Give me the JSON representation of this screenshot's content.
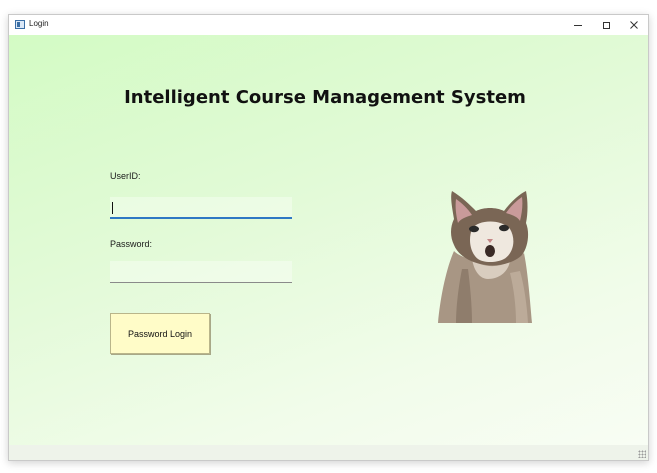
{
  "window": {
    "title": "Login",
    "icon": "app-window-icon",
    "controls": [
      "minimize-icon",
      "maximize-icon",
      "close-icon"
    ]
  },
  "heading": "Intelligent Course Management System",
  "form": {
    "userid_label": "UserID:",
    "userid_value": "",
    "password_label": "Password:",
    "password_value": "",
    "login_button": "Password Login"
  },
  "image": {
    "icon": "cat-image"
  },
  "colors": {
    "background_gradient_start": "#d3fbc4",
    "background_gradient_end": "#f8fdf4",
    "button_bg": "#fffcc8",
    "focus_underline": "#2f78c4"
  }
}
